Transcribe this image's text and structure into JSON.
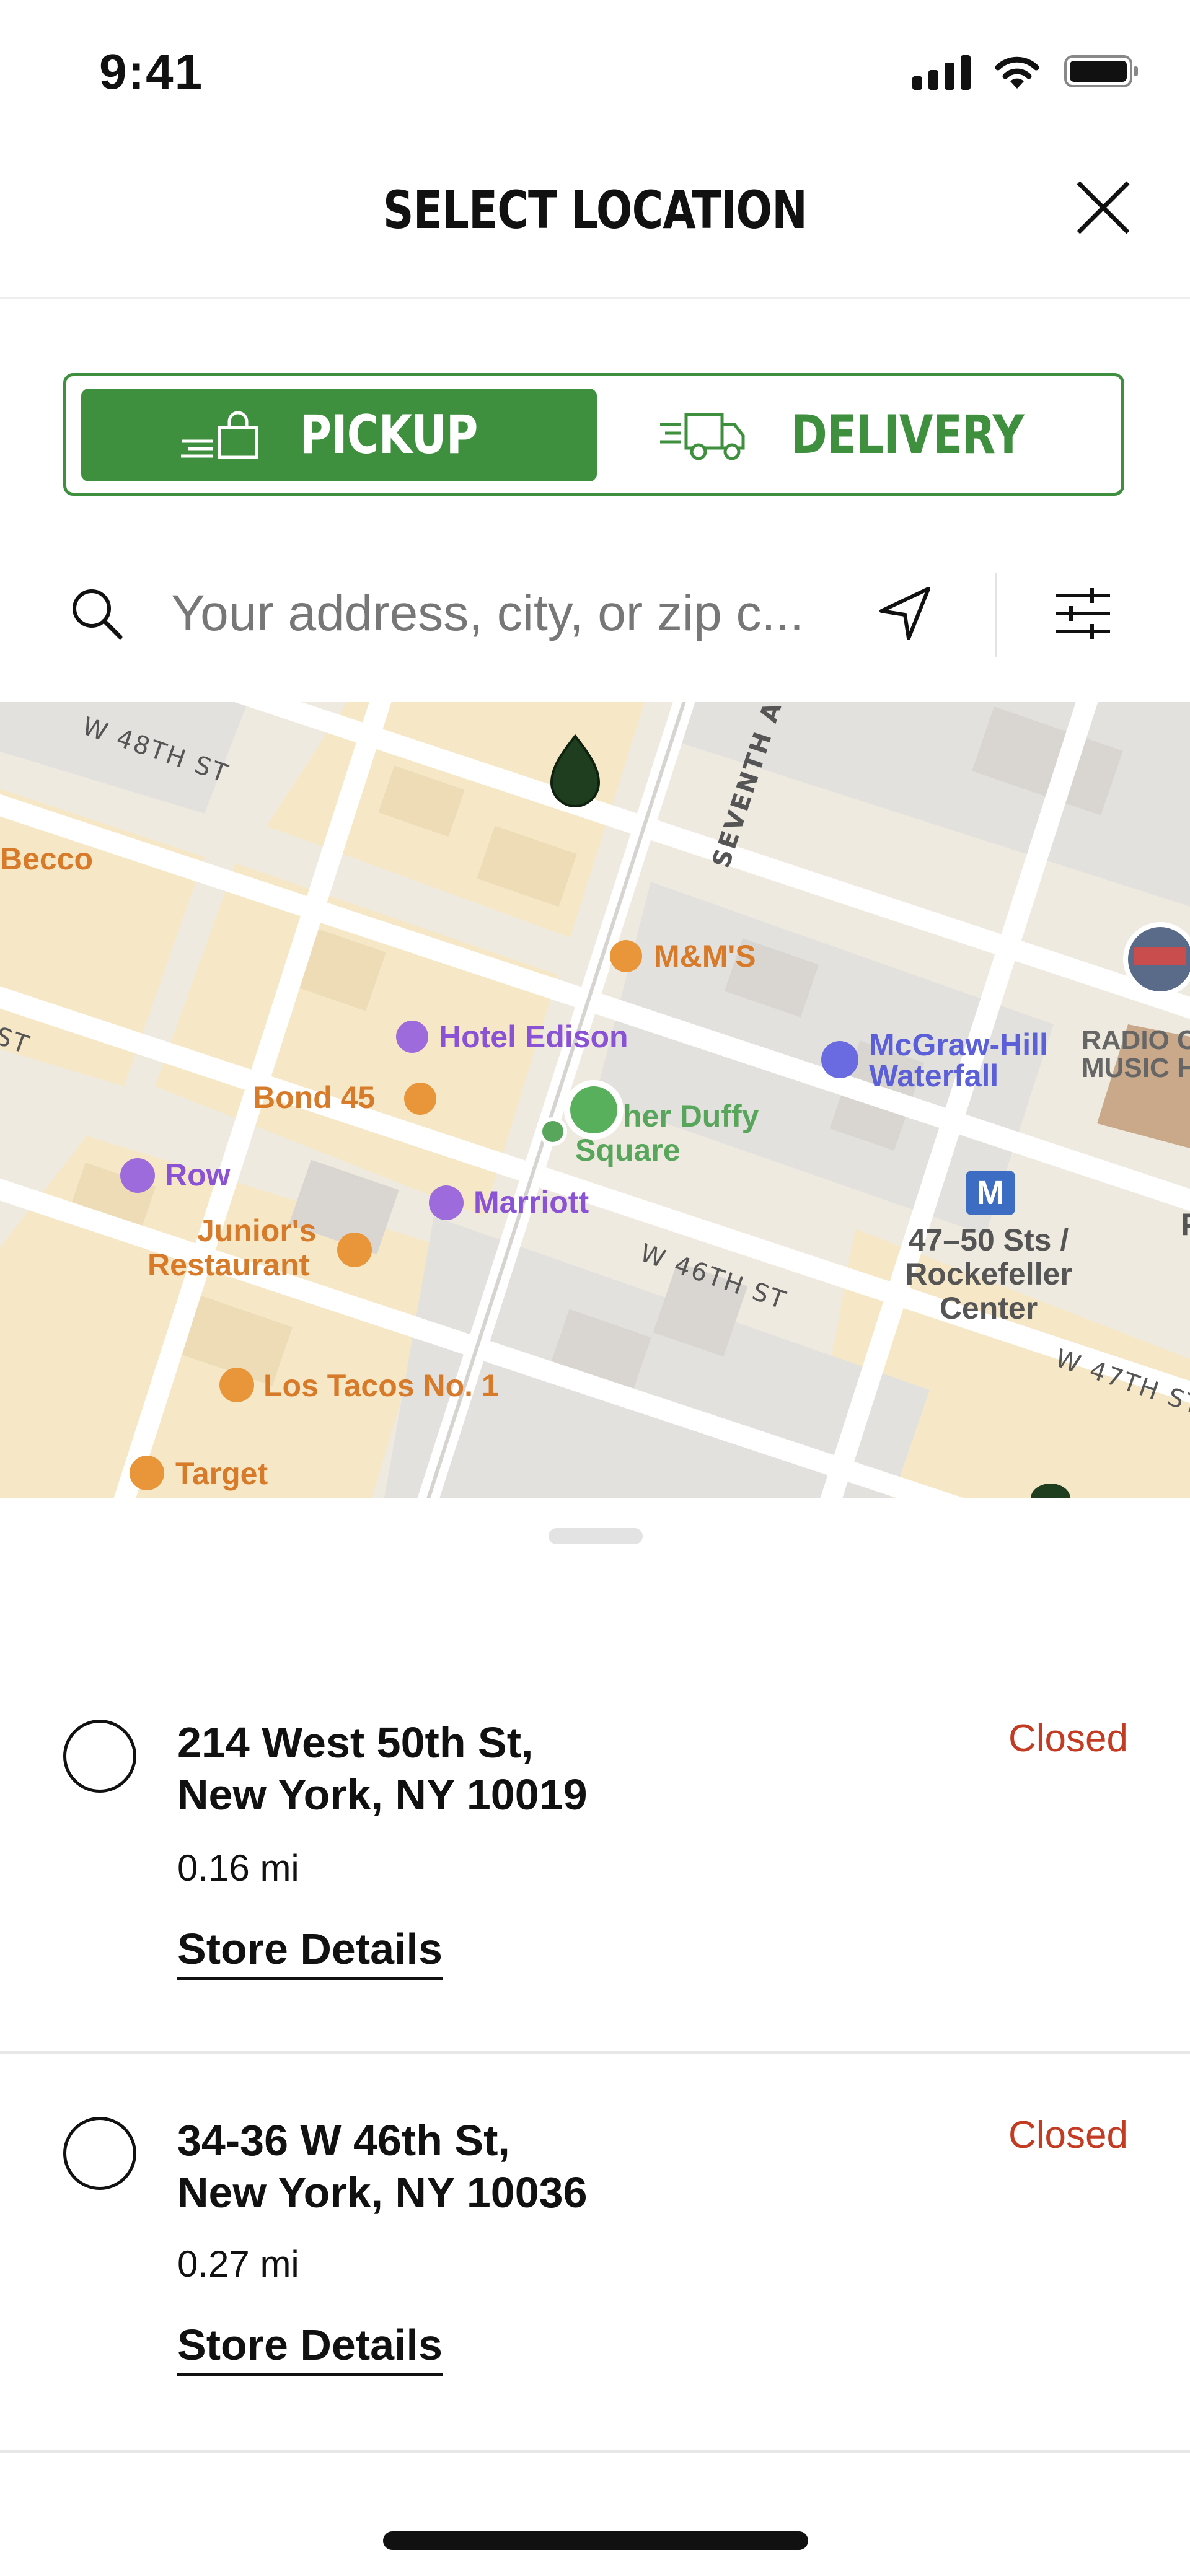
{
  "status_bar": {
    "time": "9:41"
  },
  "header": {
    "title": "SELECT LOCATION"
  },
  "mode_toggle": {
    "pickup_label": "PICKUP",
    "delivery_label": "DELIVERY",
    "selected": "pickup",
    "accent_color": "#3e8f3e"
  },
  "search": {
    "placeholder": "Your address, city, or zip c...",
    "value": ""
  },
  "map": {
    "streets": {
      "w48": "W 48TH ST",
      "seventh": "SEVENTH A",
      "w46": "W 46TH ST",
      "w47": "W 47TH ST",
      "st": "ST"
    },
    "pois": {
      "becco": "Becco",
      "mms": "M&M'S",
      "hotel_edison": "Hotel Edison",
      "mcgraw_1": "McGraw-Hill",
      "mcgraw_2": "Waterfall",
      "radio_1": "RADIO C",
      "radio_2": "MUSIC H",
      "bond45": "Bond 45",
      "duffy_1": "her Duffy",
      "duffy_2": "Square",
      "row": "Row",
      "marriott": "Marriott",
      "juniors_1": "Junior's",
      "juniors_2": "Restaurant",
      "station_1": "47–50 Sts /",
      "station_2": "Rockefeller",
      "station_3": "Center",
      "tacos": "Los Tacos No. 1",
      "target": "Target",
      "metro": "M",
      "edge_p": "P"
    }
  },
  "stores": [
    {
      "address_line1": "214 West 50th St,",
      "address_line2": "New York, NY 10019",
      "status": "Closed",
      "distance": "0.16 mi",
      "details_label": "Store Details"
    },
    {
      "address_line1": "34-36 W 46th St,",
      "address_line2": "New York, NY 10036",
      "status": "Closed",
      "distance": "0.27 mi",
      "details_label": "Store Details"
    }
  ]
}
